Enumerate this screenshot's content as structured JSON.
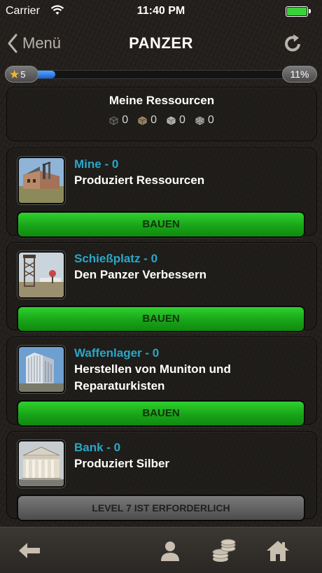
{
  "status": {
    "carrier": "Carrier",
    "time": "11:40 PM"
  },
  "nav": {
    "back_label": "Menü",
    "title": "PANZER"
  },
  "progress": {
    "level": "5",
    "percent_label": "11%",
    "percent": 11
  },
  "resources": {
    "title": "Meine Ressourcen",
    "items": [
      {
        "icon": "dark-cube-icon",
        "value": "0"
      },
      {
        "icon": "brown-cube-icon",
        "value": "0"
      },
      {
        "icon": "silver-cube-icon",
        "value": "0"
      },
      {
        "icon": "dice-cube-icon",
        "value": "0"
      }
    ]
  },
  "buildings": [
    {
      "name": "Mine - 0",
      "description": "Produziert Ressourcen",
      "button": "BAUEN",
      "thumb": "mine"
    },
    {
      "name": "Schießplatz - 0",
      "description": "Den Panzer Verbessern",
      "button": "BAUEN",
      "thumb": "range"
    },
    {
      "name": "Waffenlager - 0",
      "description": "Herstellen von Muniton und Reparaturkisten",
      "button": "BAUEN",
      "thumb": "arsenal"
    },
    {
      "name": "Bank - 0",
      "description": "Produziert Silber",
      "button": "LEVEL 7 IST ERFORDERLICH",
      "thumb": "bank"
    }
  ],
  "tabs": [
    "back-arrow-icon",
    "profile-icon",
    "coins-icon",
    "home-icon"
  ],
  "colors": {
    "accent_name": "#2aa7c9",
    "build_green": "#1fb11f",
    "locked_gray": "#5e5e5e"
  }
}
